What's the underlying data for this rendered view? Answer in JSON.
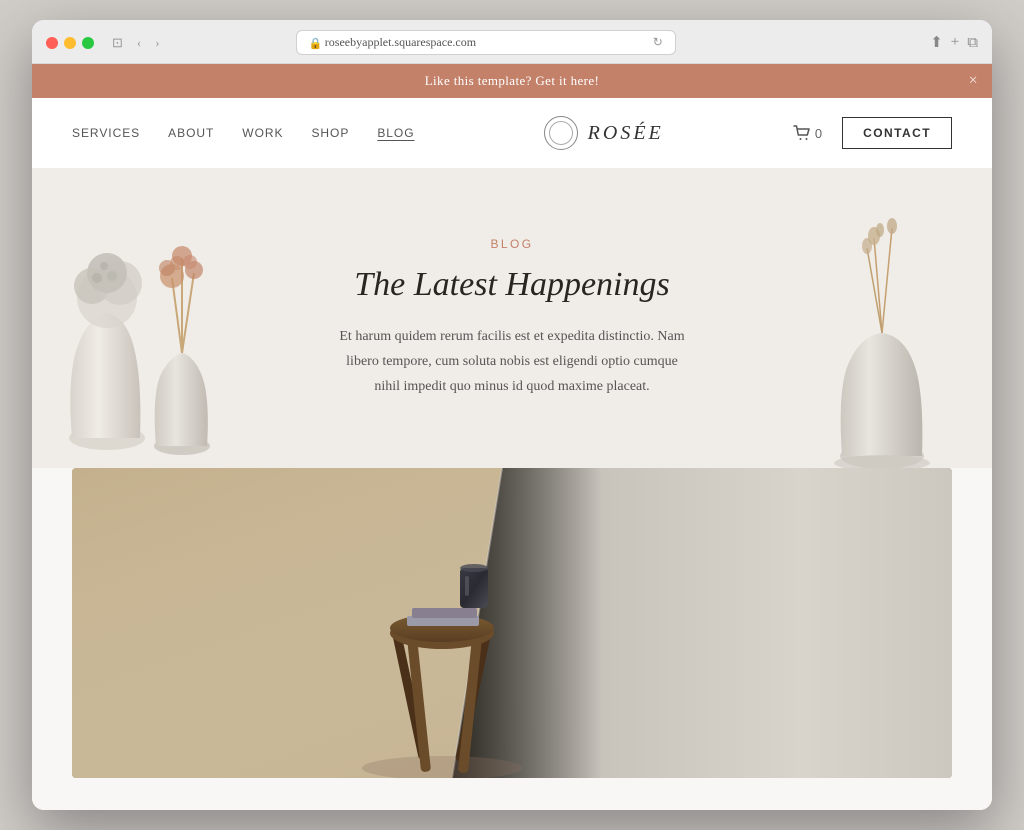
{
  "browser": {
    "url": "roseebyapplet.squarespace.com",
    "refresh_icon": "↻",
    "back_icon": "‹",
    "forward_icon": "›",
    "tab_icon": "⊡",
    "share_icon": "⬆",
    "new_tab_icon": "+",
    "copy_icon": "⧉"
  },
  "banner": {
    "text": "Like this template? Get it here!",
    "close_label": "×"
  },
  "nav": {
    "items": [
      {
        "label": "SERVICES",
        "active": false
      },
      {
        "label": "ABOUT",
        "active": false
      },
      {
        "label": "WORK",
        "active": false
      },
      {
        "label": "SHOP",
        "active": false
      },
      {
        "label": "BLOG",
        "active": true
      }
    ],
    "logo_text": "ROSÉE",
    "cart_label": "0",
    "contact_label": "CONTACT"
  },
  "hero": {
    "tag": "BLOG",
    "title": "The Latest Happenings",
    "description": "Et harum quidem rerum facilis est et expedita distinctio. Nam libero tempore, cum soluta nobis est eligendi optio cumque nihil impedit quo minus id quod maxime placeat."
  },
  "colors": {
    "banner_bg": "#c4816a",
    "accent": "#c4816a",
    "nav_bg": "#ffffff",
    "hero_bg": "#f0ece7",
    "body_bg": "#f9f7f5",
    "contact_border": "#333333"
  }
}
